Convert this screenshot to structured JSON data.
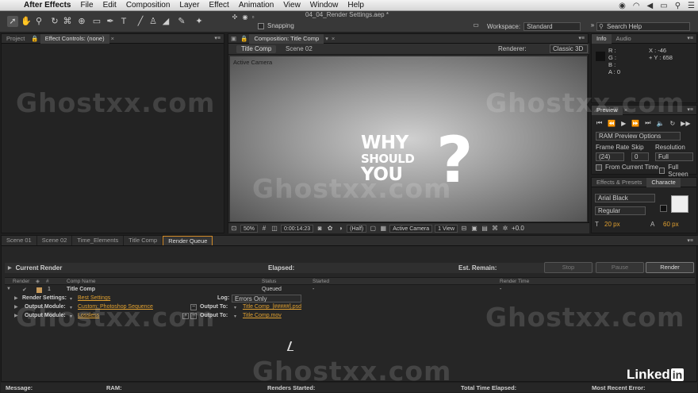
{
  "menubar": {
    "app": "After Effects",
    "items": [
      "File",
      "Edit",
      "Composition",
      "Layer",
      "Effect",
      "Animation",
      "View",
      "Window",
      "Help"
    ]
  },
  "toolbar": {
    "doc_title": "04_04_Render Settings.aep *",
    "snapping": "Snapping",
    "workspace_label": "Workspace:",
    "workspace_value": "Standard",
    "search_placeholder": "Search Help"
  },
  "left_panel": {
    "tabs": [
      "Project",
      "Effect Controls: (none)"
    ]
  },
  "comp_panel": {
    "tab": "Composition: Title Comp",
    "subtabs": [
      "Title Comp",
      "Scene 02"
    ],
    "renderer_label": "Renderer:",
    "renderer_value": "Classic 3D",
    "active_camera": "Active Camera",
    "title_lines": [
      "WHY",
      "SHOULD",
      "YOU"
    ],
    "question_mark": "?",
    "bar": {
      "zoom": "50%",
      "timecode": "0:00:14:23",
      "resolution": "(Half)",
      "camera": "Active Camera",
      "view": "1 View",
      "offset": "+0.0"
    }
  },
  "info_panel": {
    "tabs": [
      "Info",
      "Audio"
    ],
    "r": "R :",
    "g": "G :",
    "b": "B :",
    "a": "A : 0",
    "x": "X : -46",
    "y": "+ Y : 658"
  },
  "preview_panel": {
    "tab": "Preview",
    "ram_options": "RAM Preview Options",
    "frame_rate_label": "Frame Rate",
    "frame_rate": "(24)",
    "skip_label": "Skip",
    "skip": "0",
    "resolution_label": "Resolution",
    "resolution": "Full",
    "from_current": "From Current Time",
    "full_screen": "Full Screen"
  },
  "fx_panel": {
    "tabs": [
      "Effects & Presets",
      "Characte"
    ],
    "font": "Arial Black",
    "style": "Regular",
    "size": "20 px",
    "leading": "60 px"
  },
  "render_queue": {
    "tabs": [
      "Scene 01",
      "Scene 02",
      "Time_Elements",
      "Title Comp",
      "Render Queue"
    ],
    "current_render": "Current Render",
    "elapsed": "Elapsed:",
    "est_remain": "Est. Remain:",
    "stop": "Stop",
    "pause": "Pause",
    "render": "Render",
    "columns": [
      "Render",
      "#",
      "Comp Name",
      "Status",
      "Started",
      "Render Time"
    ],
    "item": {
      "index": "1",
      "comp": "Title Comp",
      "status": "Queued",
      "started": "-",
      "render_time": "-"
    },
    "render_settings_label": "Render Settings:",
    "render_settings": "Best Settings",
    "log_label": "Log:",
    "log_value": "Errors Only",
    "output_module_label": "Output Module:",
    "output_module_1": "Custom: Photoshop Sequence",
    "output_to_label": "Output To:",
    "output_to_1": "Title Comp_[#####].psd",
    "output_module_2": "Lossless",
    "output_to_2": "Title Comp.mov"
  },
  "status_bar": {
    "message": "Message:",
    "ram": "RAM:",
    "renders_started": "Renders Started:",
    "total_time": "Total Time Elapsed:",
    "recent_error": "Most Recent Error:"
  },
  "watermark": "Ghostxx.com",
  "brand": "Linked"
}
